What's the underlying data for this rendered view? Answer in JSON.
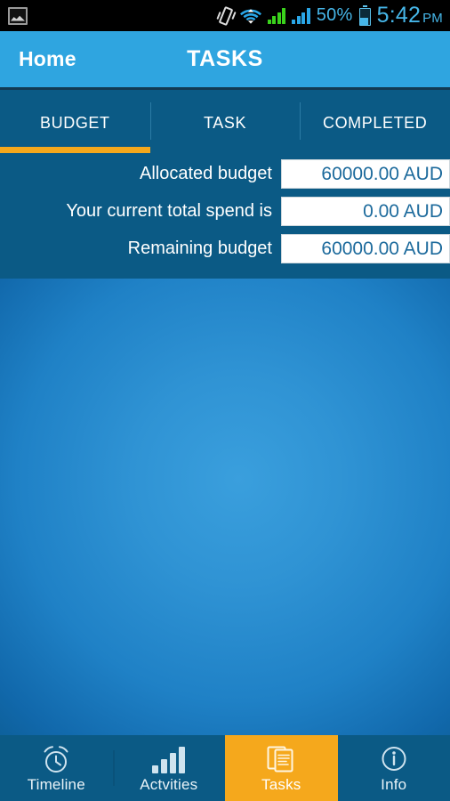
{
  "statusbar": {
    "notification_icon": "gallery-icon",
    "vibrate_icon": "vibrate-icon",
    "wifi_icon": "wifi-icon",
    "signal_icon_1": "signal-bars-green-icon",
    "signal_icon_2": "signal-bars-blue-icon",
    "battery_percent": "50%",
    "battery_icon": "battery-half-icon",
    "time": "5:42",
    "ampm": "PM"
  },
  "header": {
    "back_label": "Home",
    "title": "TASKS"
  },
  "tabs": [
    {
      "label": "BUDGET",
      "active": true
    },
    {
      "label": "TASK",
      "active": false
    },
    {
      "label": "COMPLETED",
      "active": false
    }
  ],
  "budget": {
    "rows": [
      {
        "label": "Allocated budget",
        "value": "60000.00 AUD"
      },
      {
        "label": "Your current total spend is",
        "value": "0.00 AUD"
      },
      {
        "label": "Remaining budget",
        "value": "60000.00 AUD"
      }
    ]
  },
  "bottom_nav": [
    {
      "label": "Timeline",
      "icon": "alarm-clock-icon",
      "active": false
    },
    {
      "label": "Actvities",
      "icon": "bar-chart-icon",
      "active": false
    },
    {
      "label": "Tasks",
      "icon": "documents-icon",
      "active": true
    },
    {
      "label": "Info",
      "icon": "info-circle-icon",
      "active": false
    }
  ],
  "colors": {
    "accent_orange": "#f5a81c",
    "header_blue": "#2fa5e0",
    "panel_blue": "#0b5a85",
    "status_text_blue": "#46b6e8",
    "field_text_blue": "#1c6a9c"
  }
}
